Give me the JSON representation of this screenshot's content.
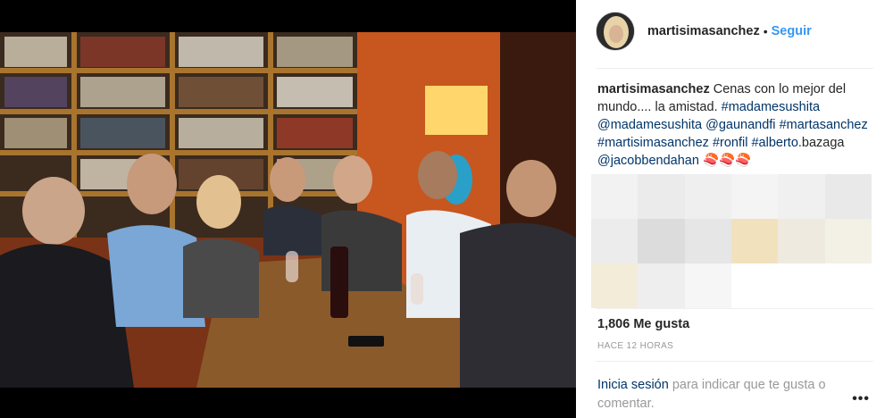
{
  "post": {
    "username": "martisimasanchez",
    "follow_label": "Seguir",
    "separator": "•"
  },
  "caption": {
    "username": "martisimasanchez",
    "text": "Cenas con lo mejor del mundo.... la amistad.",
    "tags": [
      "#madamesushita",
      "@madamesushita",
      "@gaunandfi",
      "#martasanchez",
      "#martisimasanchez",
      "#ronfil",
      "#alberto",
      "@jacobbendahan"
    ],
    "tag_suffix": ".bazaga",
    "emoji": "🍣🍣🍣"
  },
  "stats": {
    "likes": "1,806 Me gusta",
    "time": "HACE 12 HORAS"
  },
  "login": {
    "link": "Inicia sesión",
    "rest": " para indicar que te gusta o comentar."
  },
  "more_icon": "more-options-icon",
  "more_glyph": "•••",
  "pixel_colors": [
    "#f2f2f2",
    "#ebebeb",
    "#efefef",
    "#f4f4f4",
    "#f0f0f0",
    "#e9e9e9",
    "#ececec",
    "#dcdcdc",
    "#e6e6e6",
    "#f1e2bd",
    "#eeeae0",
    "#f3f0e6",
    "#f3ecd9",
    "#eeeeee",
    "#f6f6f6",
    "#ffffff",
    "#ffffff",
    "#ffffff"
  ]
}
